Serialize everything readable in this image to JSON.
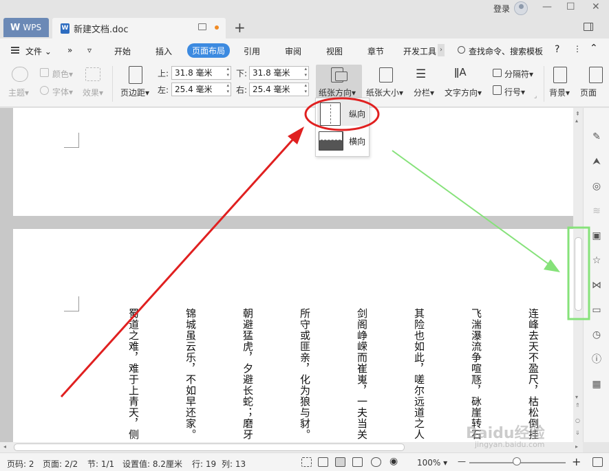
{
  "titlebar": {
    "app_tab": "WPS",
    "doc_tab": "新建文档.doc",
    "doc_icon": "W",
    "add_tab": "+",
    "login": "登录",
    "minimize": "—",
    "maximize": "☐",
    "close": "✕"
  },
  "menubar": {
    "file": "文件",
    "items": [
      "开始",
      "插入",
      "页面布局",
      "引用",
      "审阅",
      "视图",
      "章节",
      "开发工具"
    ],
    "active": "页面布局",
    "search": "查找命令、搜索模板",
    "help": "?"
  },
  "ribbon": {
    "theme": "主题",
    "colors": "颜色",
    "font": "字体",
    "effects": "效果",
    "margins": "页边距",
    "top_label": "上:",
    "top_value": "31.8 毫米",
    "bottom_label": "下:",
    "bottom_value": "31.8 毫米",
    "left_label": "左:",
    "left_value": "25.4 毫米",
    "right_label": "右:",
    "right_value": "25.4 毫米",
    "orientation": "纸张方向",
    "paper_size": "纸张大小",
    "columns": "分栏",
    "text_direction": "文字方向",
    "separator": "分隔符",
    "line_number": "行号",
    "background": "背景",
    "page_border": "页面"
  },
  "dropdown": {
    "portrait": "纵向",
    "landscape": "横向"
  },
  "document": {
    "columns": [
      "连峰去天不盈尺，枯松倒挂",
      "飞湍瀑流争喧豗，砯崖转石",
      "其险也如此，嗟尔远道之人",
      "剑阁峥嵘而崔嵬，一夫当关",
      "所守或匪亲，化为狼与豺。",
      "朝避猛虎，夕避长蛇；磨牙",
      "锦城虽云乐，不如早还家。",
      "蜀道之难，难于上青天，侧"
    ]
  },
  "statusbar": {
    "page_num": "页码: 2",
    "pages": "页面: 2/2",
    "section": "节: 1/1",
    "setting": "设置值: 8.2厘米",
    "row": "行: 19",
    "col": "列: 13",
    "zoom": "100%",
    "zoom_minus": "—",
    "zoom_plus": "+"
  },
  "watermark": {
    "main": "Baidu经验",
    "sub": "jingyan.baidu.com"
  },
  "colors": {
    "active_tab": "#3c8ae0",
    "red_annotation": "#e02020",
    "green_annotation": "#86e27a"
  }
}
